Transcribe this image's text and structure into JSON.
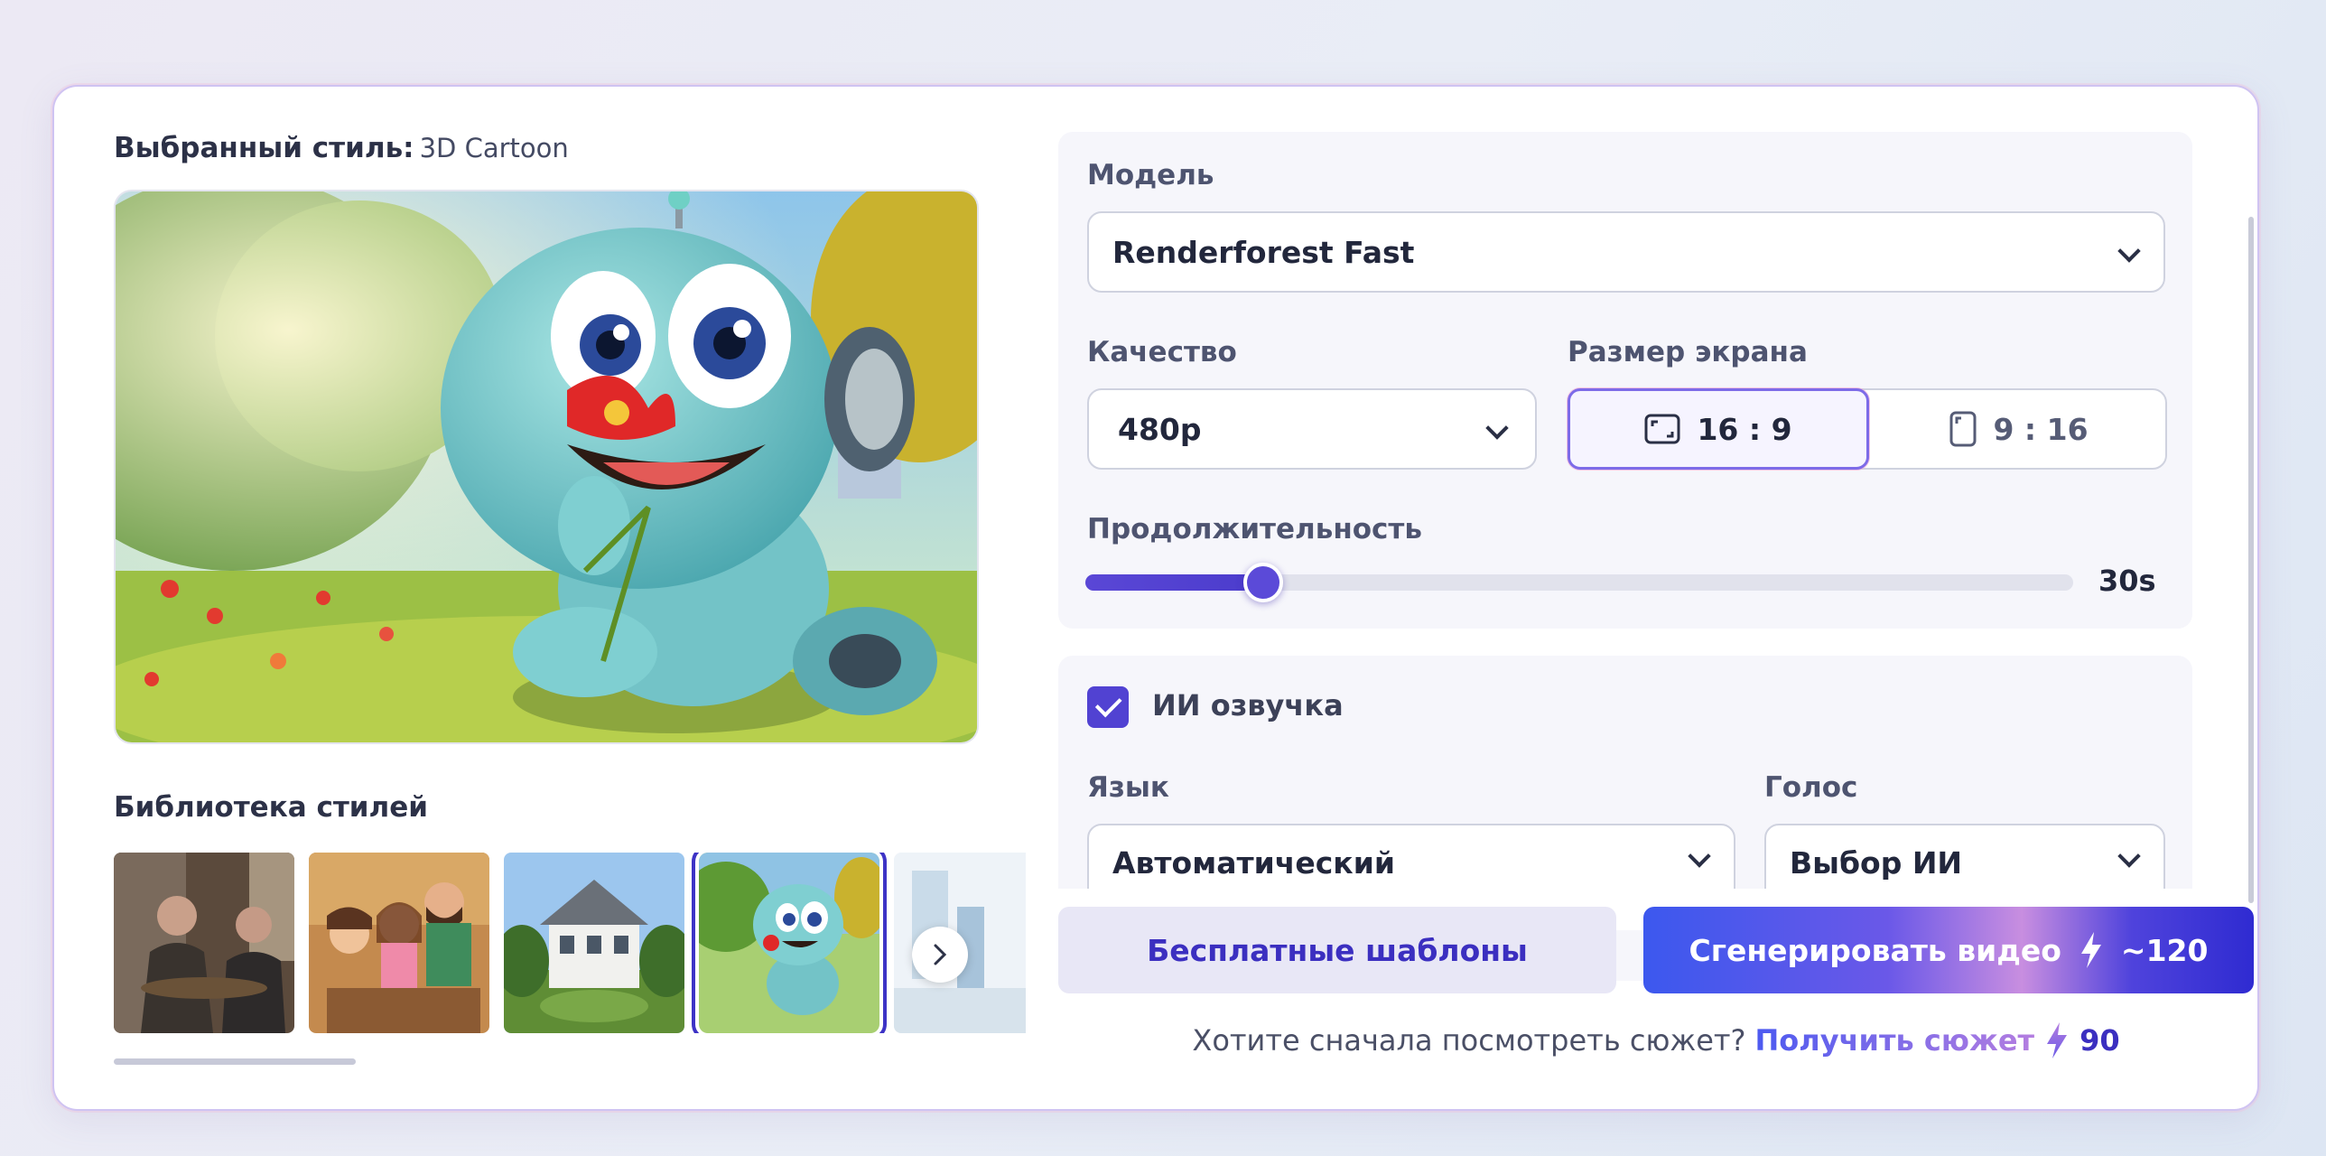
{
  "selected_style": {
    "label": "Выбранный стиль:",
    "value": "3D Cartoon"
  },
  "library": {
    "title": "Библиотека стилей",
    "thumbnails": [
      {
        "name": "cinematic-people"
      },
      {
        "name": "animated-family"
      },
      {
        "name": "realistic-house"
      },
      {
        "name": "3d-cartoon-robot"
      },
      {
        "name": "flat-illustration"
      }
    ],
    "selected_index": 3
  },
  "model": {
    "label": "Модель",
    "value": "Renderforest Fast"
  },
  "quality": {
    "label": "Качество",
    "value": "480p"
  },
  "screen_size": {
    "label": "Размер экрана",
    "options": [
      {
        "label": "16 : 9",
        "icon": "landscape-frame-icon"
      },
      {
        "label": "9 : 16",
        "icon": "portrait-frame-icon"
      }
    ],
    "selected": "16 : 9"
  },
  "duration": {
    "label": "Продолжительность",
    "value": "30s",
    "fraction": 0.18
  },
  "voiceover": {
    "label": "ИИ озвучка",
    "checked": true
  },
  "language": {
    "label": "Язык",
    "value": "Автоматический"
  },
  "voice": {
    "label": "Голос",
    "value": "Выбор ИИ"
  },
  "buttons": {
    "free_templates": "Бесплатные шаблоны",
    "generate": "Сгенерировать видео",
    "generate_cost": "~120"
  },
  "footer": {
    "question": "Хотите сначала посмотреть сюжет?",
    "link": "Получить сюжет",
    "cost": "90"
  },
  "colors": {
    "accent": "#4f3fd3",
    "link_gradient_start": "#4c5af0",
    "link_gradient_end": "#b47ee0"
  }
}
